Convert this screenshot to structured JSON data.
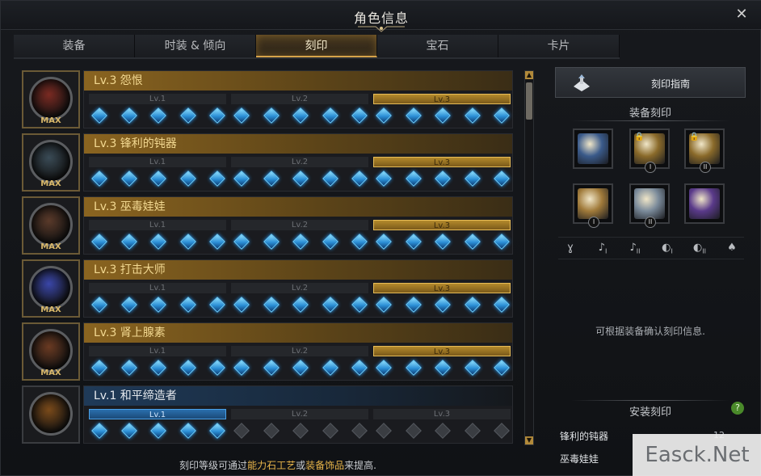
{
  "window": {
    "title": "角色信息",
    "close_label": "✕"
  },
  "tabs": [
    {
      "label": "装备",
      "active": false
    },
    {
      "label": "时装 & 倾向",
      "active": false
    },
    {
      "label": "刻印",
      "active": true
    },
    {
      "label": "宝石",
      "active": false
    },
    {
      "label": "卡片",
      "active": false
    }
  ],
  "engravings": [
    {
      "title": "Lv.3 怨恨",
      "badge": "MAX",
      "style": "gold",
      "icon_color": "#7a2a22",
      "levels": [
        {
          "label": "Lv.1",
          "state": "full"
        },
        {
          "label": "Lv.2",
          "state": "full"
        },
        {
          "label": "Lv.3",
          "state": "current"
        }
      ]
    },
    {
      "title": "Lv.3 锋利的钝器",
      "badge": "MAX",
      "style": "gold",
      "icon_color": "#3a4b56",
      "levels": [
        {
          "label": "Lv.1",
          "state": "full"
        },
        {
          "label": "Lv.2",
          "state": "full"
        },
        {
          "label": "Lv.3",
          "state": "current"
        }
      ]
    },
    {
      "title": "Lv.3 巫毒娃娃",
      "badge": "MAX",
      "style": "gold",
      "icon_color": "#5a3a2a",
      "levels": [
        {
          "label": "Lv.1",
          "state": "full"
        },
        {
          "label": "Lv.2",
          "state": "full"
        },
        {
          "label": "Lv.3",
          "state": "current"
        }
      ]
    },
    {
      "title": "Lv.3 打击大师",
      "badge": "MAX",
      "style": "gold",
      "icon_color": "#3a46a8",
      "levels": [
        {
          "label": "Lv.1",
          "state": "full"
        },
        {
          "label": "Lv.2",
          "state": "full"
        },
        {
          "label": "Lv.3",
          "state": "current"
        }
      ]
    },
    {
      "title": "Lv.3 肾上腺素",
      "badge": "MAX",
      "style": "gold",
      "icon_color": "#6a3a22",
      "levels": [
        {
          "label": "Lv.1",
          "state": "full"
        },
        {
          "label": "Lv.2",
          "state": "full"
        },
        {
          "label": "Lv.3",
          "state": "current"
        }
      ]
    },
    {
      "title": "Lv.1 和平缔造者",
      "badge": "",
      "style": "blue",
      "icon_color": "#7a4a1a",
      "levels": [
        {
          "label": "Lv.1",
          "state": "current"
        },
        {
          "label": "Lv.2",
          "state": "empty"
        },
        {
          "label": "Lv.3",
          "state": "empty"
        }
      ]
    }
  ],
  "footer": {
    "prefix": "刻印等级可通过",
    "link1": "能力石工艺",
    "mid": "或",
    "link2": "装备饰品",
    "suffix": "来提高."
  },
  "right_panel": {
    "guide_label": "刻印指南",
    "equip_title": "装备刻印",
    "slots": [
      {
        "name": "necklace",
        "color": "#3a5a8a",
        "locked": false,
        "badge": ""
      },
      {
        "name": "earring-1",
        "color": "#8a6a2a",
        "locked": true,
        "badge": "I"
      },
      {
        "name": "earring-2",
        "color": "#8a6a2a",
        "locked": true,
        "badge": "II"
      },
      {
        "name": "ring-1",
        "color": "#a07a3a",
        "locked": false,
        "badge": "I"
      },
      {
        "name": "ring-2",
        "color": "#7a8a9a",
        "locked": false,
        "badge": "II"
      },
      {
        "name": "stone",
        "color": "#5a3a8a",
        "locked": false,
        "badge": ""
      }
    ],
    "filters": [
      "necklace-icon",
      "earring-1-icon",
      "earring-2-icon",
      "ring-1-icon",
      "ring-2-icon",
      "stone-icon"
    ],
    "info_text": "可根据装备确认刻印信息.",
    "install_title": "安装刻印",
    "help_label": "?",
    "installed": [
      {
        "name": "锋利的钝器",
        "value": "12"
      },
      {
        "name": "巫毒娃娃",
        "value": ""
      }
    ]
  },
  "watermark": "Easck.Net"
}
